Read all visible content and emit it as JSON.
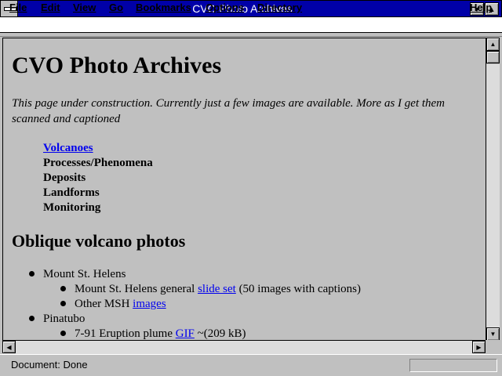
{
  "window": {
    "title": "CVO Photo Archives",
    "minimize_icon": "triangle-down",
    "maximize_icon": "triangle-up"
  },
  "menubar": {
    "items": [
      "File",
      "Edit",
      "View",
      "Go",
      "Bookmarks",
      "Options",
      "Directory",
      "Help"
    ]
  },
  "page": {
    "heading": "CVO Photo Archives",
    "intro": "This page under construction. Currently just a few images are available. More as I get them scanned and captioned",
    "toc": {
      "link": "Volcanoes",
      "items": [
        "Processes/Phenomena",
        "Deposits",
        "Landforms",
        "Monitoring"
      ]
    },
    "section_heading": "Oblique volcano photos",
    "list": [
      {
        "name": "Mount St. Helens",
        "sub": [
          {
            "before": "Mount St. Helens general ",
            "link": "slide set",
            "after": " (50 images with captions)"
          },
          {
            "before": "Other MSH ",
            "link": "images",
            "after": ""
          }
        ]
      },
      {
        "name": "Pinatubo",
        "sub": [
          {
            "before": "7-91 Eruption plume ",
            "link": "GIF",
            "after": " ~(209 kB)"
          }
        ]
      }
    ],
    "link_color": "#0000ee"
  },
  "statusbar": {
    "text": "Document: Done"
  },
  "colors": {
    "titlebar": "#0000a8",
    "background": "#c0c0c0"
  }
}
